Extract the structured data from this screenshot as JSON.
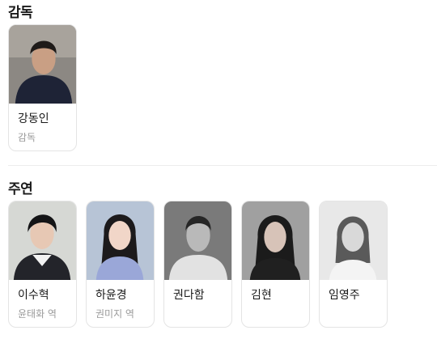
{
  "director_section": {
    "title": "감독",
    "people": [
      {
        "name": "강동인",
        "role": "감독",
        "photo_icon": "person-photo"
      }
    ]
  },
  "cast_section": {
    "title": "주연",
    "people": [
      {
        "name": "이수혁",
        "role": "윤태화 역",
        "photo_icon": "person-photo"
      },
      {
        "name": "하윤경",
        "role": "권미지 역",
        "photo_icon": "person-photo"
      },
      {
        "name": "권다함",
        "role": "",
        "photo_icon": "person-photo"
      },
      {
        "name": "김현",
        "role": "",
        "photo_icon": "person-photo"
      },
      {
        "name": "임영주",
        "role": "",
        "photo_icon": "person-photo"
      }
    ]
  }
}
